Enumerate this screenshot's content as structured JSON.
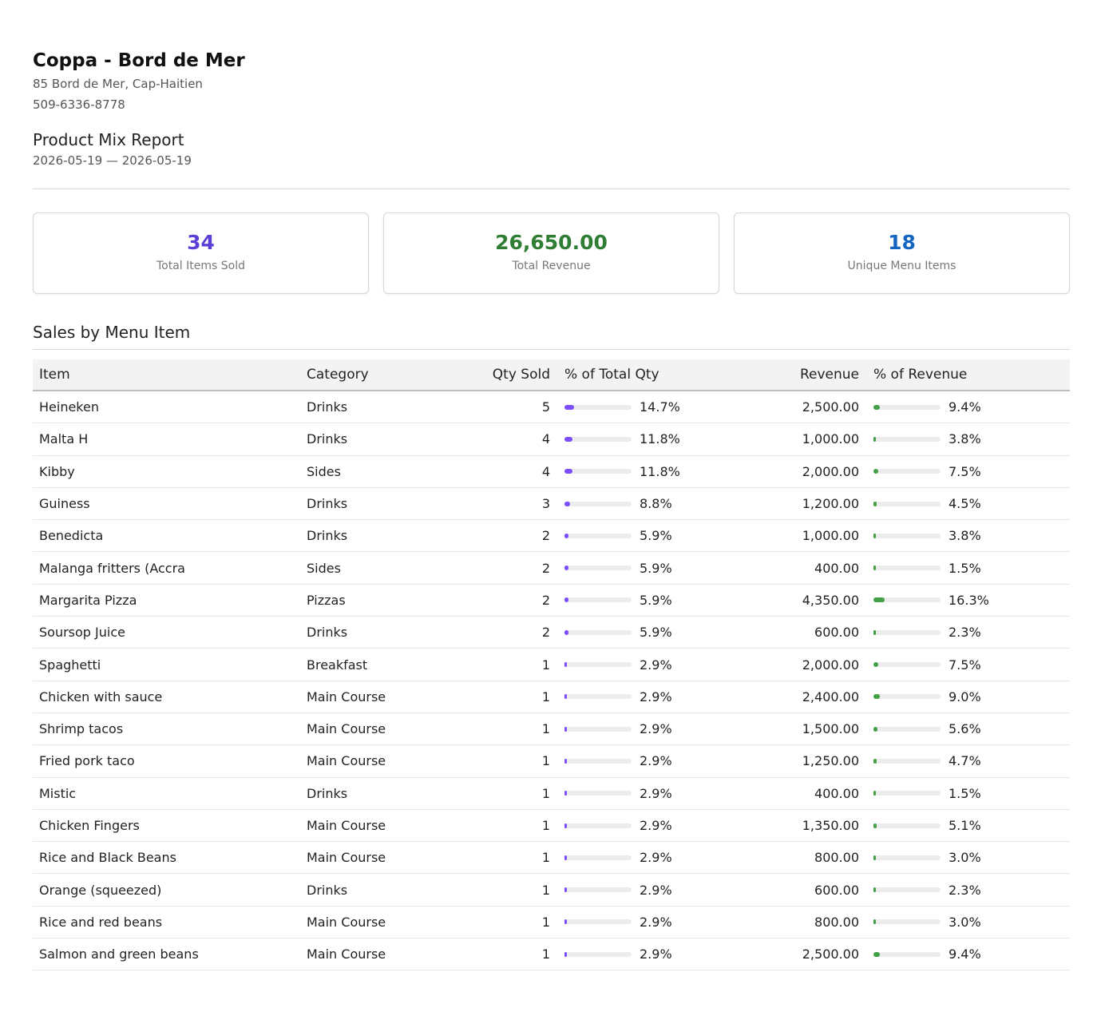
{
  "business": {
    "name": "Coppa - Bord de Mer",
    "address": "85 Bord de Mer, Cap-Haitien",
    "phone": "509-6336-8778"
  },
  "report": {
    "title": "Product Mix Report",
    "date_range": "2026-05-19 — 2026-05-19"
  },
  "summary": [
    {
      "value": "34",
      "label": "Total Items Sold",
      "color": "#5b3fd6"
    },
    {
      "value": "26,650.00",
      "label": "Total Revenue",
      "color": "#2e7d32"
    },
    {
      "value": "18",
      "label": "Unique Menu Items",
      "color": "#1565c0"
    }
  ],
  "colors": {
    "qty_bar": "#7c4dff",
    "revenue_bar": "#43a047",
    "bar_track": "#ececec"
  },
  "section": {
    "title": "Sales by Menu Item"
  },
  "table": {
    "headers": {
      "item": "Item",
      "category": "Category",
      "qty": "Qty Sold",
      "pct_qty": "% of Total Qty",
      "revenue": "Revenue",
      "pct_revenue": "% of Revenue"
    },
    "rows": [
      {
        "item": "Heineken",
        "category": "Drinks",
        "qty": "5",
        "pct_qty": "14.7%",
        "pct_qty_value": 14.7,
        "revenue": "2,500.00",
        "pct_rev": "9.4%",
        "pct_rev_value": 9.4
      },
      {
        "item": "Malta H",
        "category": "Drinks",
        "qty": "4",
        "pct_qty": "11.8%",
        "pct_qty_value": 11.8,
        "revenue": "1,000.00",
        "pct_rev": "3.8%",
        "pct_rev_value": 3.8
      },
      {
        "item": "Kibby",
        "category": "Sides",
        "qty": "4",
        "pct_qty": "11.8%",
        "pct_qty_value": 11.8,
        "revenue": "2,000.00",
        "pct_rev": "7.5%",
        "pct_rev_value": 7.5
      },
      {
        "item": "Guiness",
        "category": "Drinks",
        "qty": "3",
        "pct_qty": "8.8%",
        "pct_qty_value": 8.8,
        "revenue": "1,200.00",
        "pct_rev": "4.5%",
        "pct_rev_value": 4.5
      },
      {
        "item": "Benedicta",
        "category": "Drinks",
        "qty": "2",
        "pct_qty": "5.9%",
        "pct_qty_value": 5.9,
        "revenue": "1,000.00",
        "pct_rev": "3.8%",
        "pct_rev_value": 3.8
      },
      {
        "item": "Malanga fritters (Accra",
        "category": "Sides",
        "qty": "2",
        "pct_qty": "5.9%",
        "pct_qty_value": 5.9,
        "revenue": "400.00",
        "pct_rev": "1.5%",
        "pct_rev_value": 1.5
      },
      {
        "item": "Margarita Pizza",
        "category": "Pizzas",
        "qty": "2",
        "pct_qty": "5.9%",
        "pct_qty_value": 5.9,
        "revenue": "4,350.00",
        "pct_rev": "16.3%",
        "pct_rev_value": 16.3
      },
      {
        "item": "Soursop Juice",
        "category": "Drinks",
        "qty": "2",
        "pct_qty": "5.9%",
        "pct_qty_value": 5.9,
        "revenue": "600.00",
        "pct_rev": "2.3%",
        "pct_rev_value": 2.3
      },
      {
        "item": "Spaghetti",
        "category": "Breakfast",
        "qty": "1",
        "pct_qty": "2.9%",
        "pct_qty_value": 2.9,
        "revenue": "2,000.00",
        "pct_rev": "7.5%",
        "pct_rev_value": 7.5
      },
      {
        "item": "Chicken with sauce",
        "category": "Main Course",
        "qty": "1",
        "pct_qty": "2.9%",
        "pct_qty_value": 2.9,
        "revenue": "2,400.00",
        "pct_rev": "9.0%",
        "pct_rev_value": 9.0
      },
      {
        "item": "Shrimp tacos",
        "category": "Main Course",
        "qty": "1",
        "pct_qty": "2.9%",
        "pct_qty_value": 2.9,
        "revenue": "1,500.00",
        "pct_rev": "5.6%",
        "pct_rev_value": 5.6
      },
      {
        "item": "Fried pork taco",
        "category": "Main Course",
        "qty": "1",
        "pct_qty": "2.9%",
        "pct_qty_value": 2.9,
        "revenue": "1,250.00",
        "pct_rev": "4.7%",
        "pct_rev_value": 4.7
      },
      {
        "item": "Mistic",
        "category": "Drinks",
        "qty": "1",
        "pct_qty": "2.9%",
        "pct_qty_value": 2.9,
        "revenue": "400.00",
        "pct_rev": "1.5%",
        "pct_rev_value": 1.5
      },
      {
        "item": "Chicken Fingers",
        "category": "Main Course",
        "qty": "1",
        "pct_qty": "2.9%",
        "pct_qty_value": 2.9,
        "revenue": "1,350.00",
        "pct_rev": "5.1%",
        "pct_rev_value": 5.1
      },
      {
        "item": "Rice and Black Beans",
        "category": "Main Course",
        "qty": "1",
        "pct_qty": "2.9%",
        "pct_qty_value": 2.9,
        "revenue": "800.00",
        "pct_rev": "3.0%",
        "pct_rev_value": 3.0
      },
      {
        "item": "Orange (squeezed)",
        "category": "Drinks",
        "qty": "1",
        "pct_qty": "2.9%",
        "pct_qty_value": 2.9,
        "revenue": "600.00",
        "pct_rev": "2.3%",
        "pct_rev_value": 2.3
      },
      {
        "item": "Rice and red beans",
        "category": "Main Course",
        "qty": "1",
        "pct_qty": "2.9%",
        "pct_qty_value": 2.9,
        "revenue": "800.00",
        "pct_rev": "3.0%",
        "pct_rev_value": 3.0
      },
      {
        "item": "Salmon and green beans",
        "category": "Main Course",
        "qty": "1",
        "pct_qty": "2.9%",
        "pct_qty_value": 2.9,
        "revenue": "2,500.00",
        "pct_rev": "9.4%",
        "pct_rev_value": 9.4
      }
    ]
  }
}
